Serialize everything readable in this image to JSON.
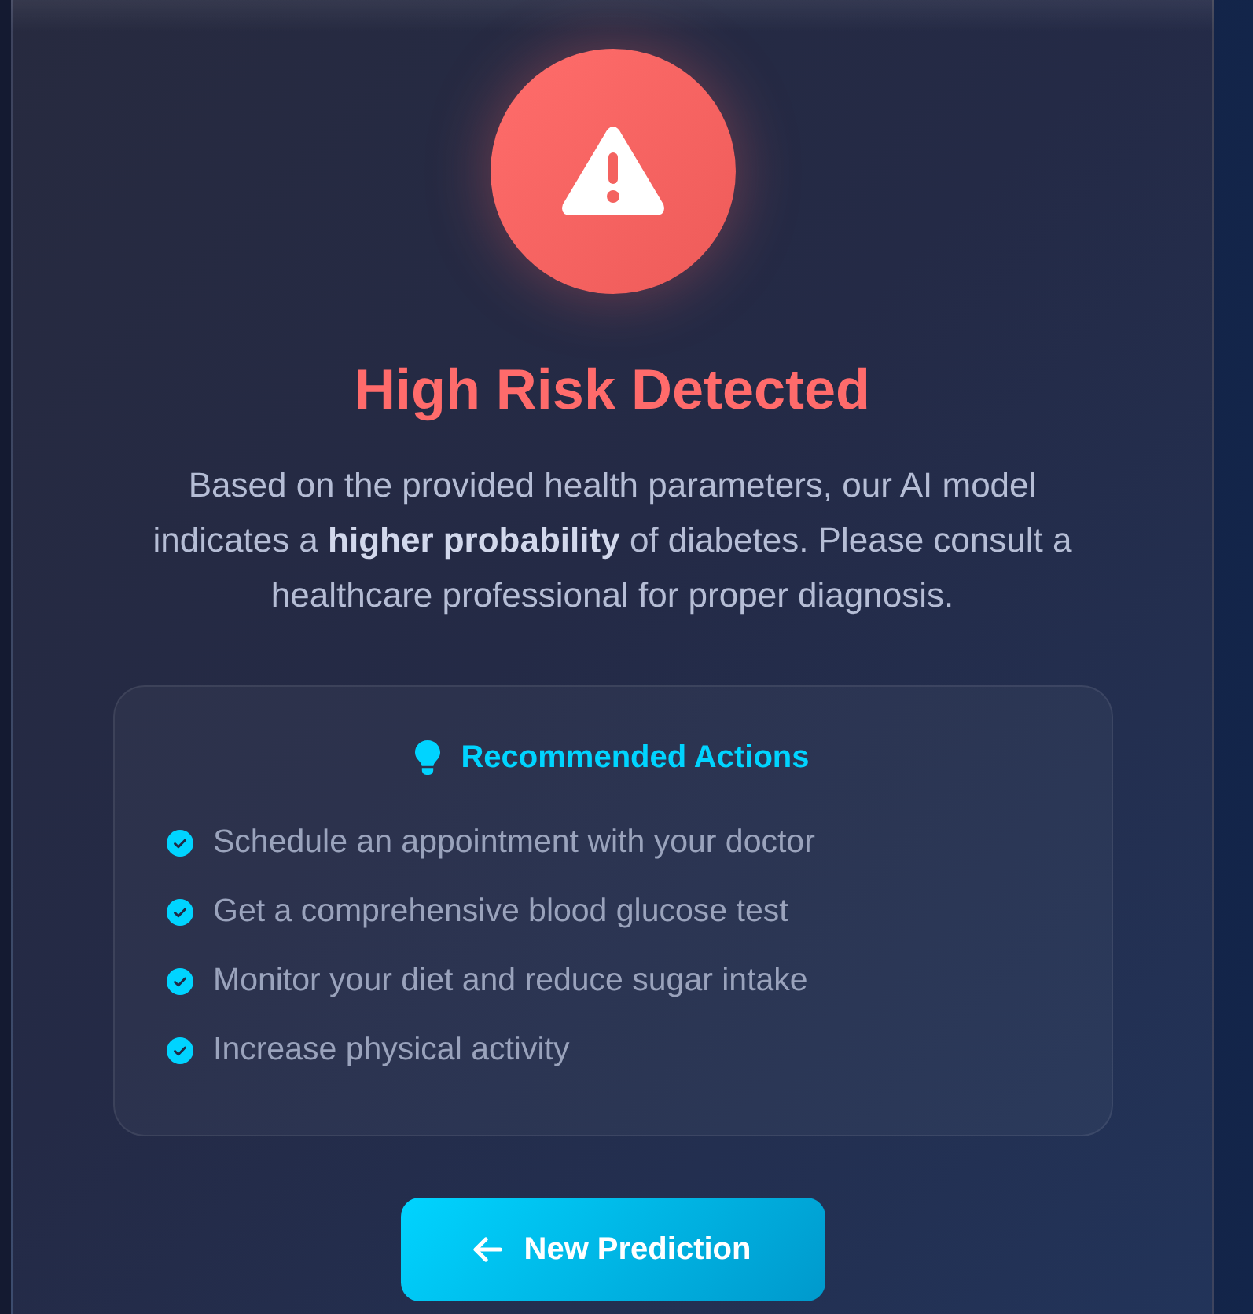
{
  "result": {
    "title": "High Risk Detected",
    "message": "Based on the provided health parameters, our AI model indicates a **higher probability** of diabetes. Please consult a healthcare professional for proper diagnosis."
  },
  "recommendations": {
    "title": "Recommended Actions",
    "items": [
      "Schedule an appointment with your doctor",
      "Get a comprehensive blood glucose test",
      "Monitor your diet and reduce sugar intake",
      "Increase physical activity"
    ]
  },
  "action_button": {
    "label": "New Prediction"
  }
}
